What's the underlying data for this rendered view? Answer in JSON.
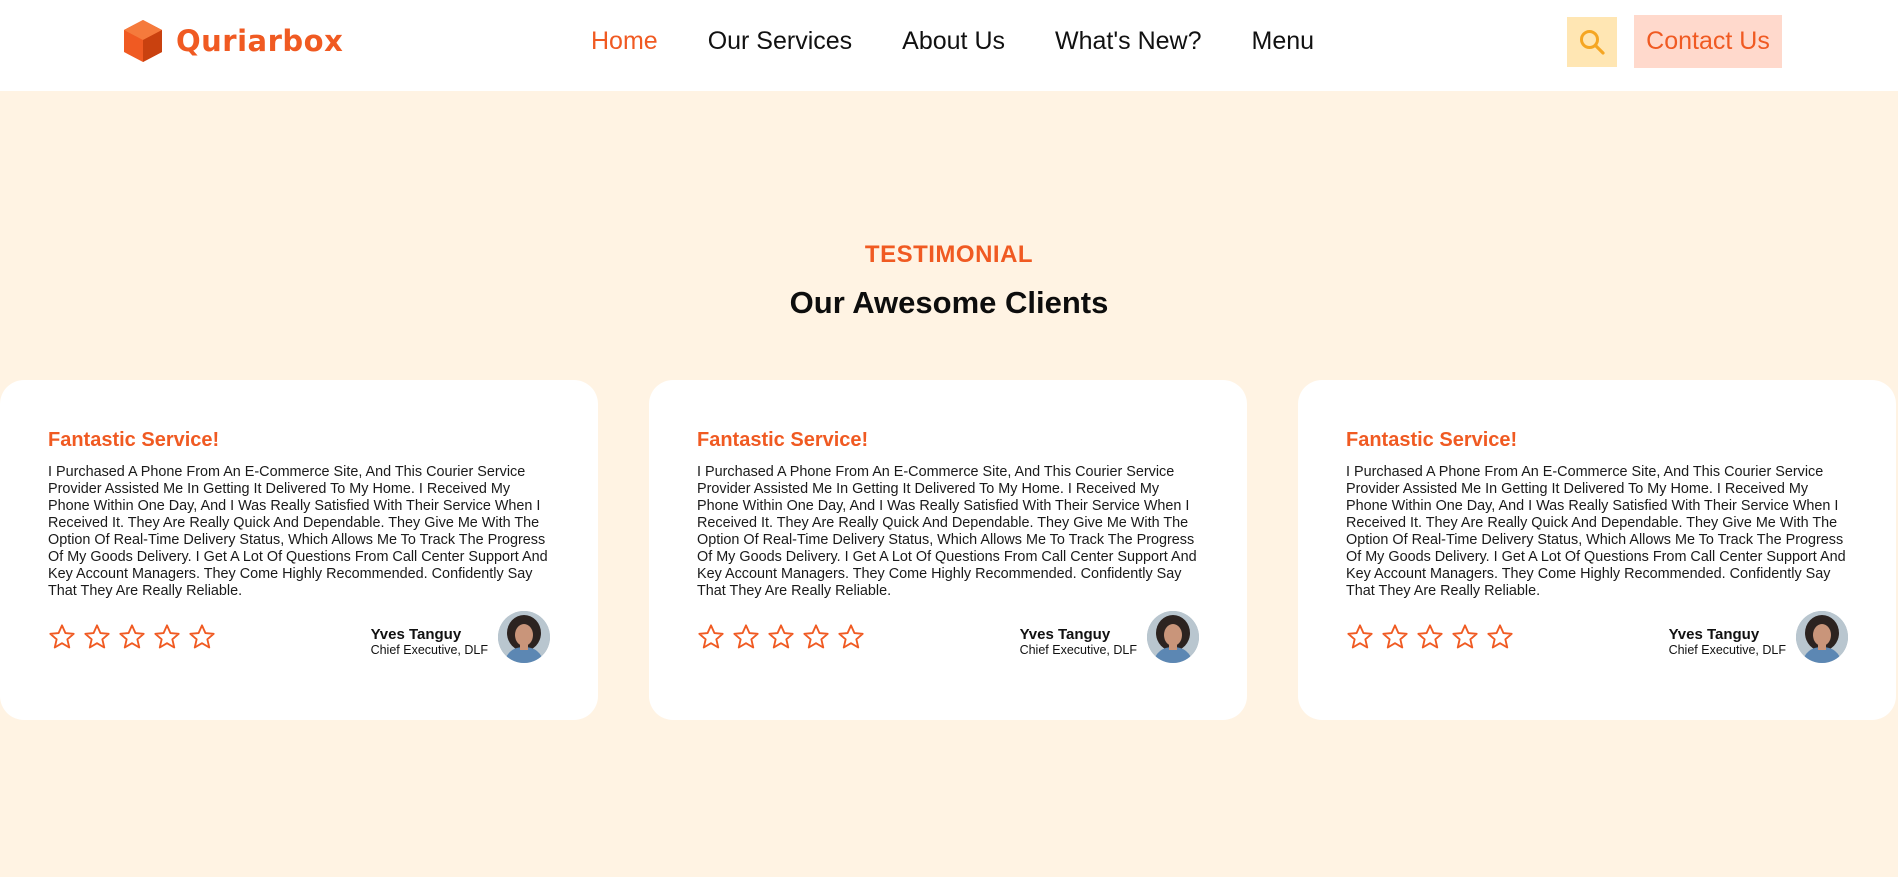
{
  "brand": {
    "name": "Quriarbox",
    "accent_color": "#f05a22",
    "background_color": "#fff3e3"
  },
  "nav": {
    "items": [
      {
        "label": "Home",
        "active": true
      },
      {
        "label": "Our Services",
        "active": false
      },
      {
        "label": "About Us",
        "active": false
      },
      {
        "label": "What's New?",
        "active": false
      },
      {
        "label": "Menu",
        "active": false
      }
    ]
  },
  "header": {
    "search_icon": "search-icon",
    "contact_label": "Contact Us"
  },
  "testimonial": {
    "eyebrow": "TESTIMONIAL",
    "title": "Our Awesome Clients",
    "cards": [
      {
        "title": "Fantastic Service!",
        "text": "I Purchased A Phone From An E-Commerce Site, And This Courier Service Provider Assisted Me In Getting It Delivered To My Home. I Received My Phone Within One Day, And I Was Really Satisfied With Their Service When I Received It. They Are Really Quick And Dependable. They Give Me With The Option Of Real-Time Delivery Status, Which Allows Me To Track The Progress Of My Goods Delivery. I Get A Lot Of Questions From Call Center Support And Key Account Managers. They Come Highly Recommended. Confidently Say That They Are Really Reliable.",
        "rating": 0,
        "rating_max": 5,
        "author": "Yves Tanguy",
        "role": "Chief Executive, DLF"
      },
      {
        "title": "Fantastic Service!",
        "text": "I Purchased A Phone From An E-Commerce Site, And This Courier Service Provider Assisted Me In Getting It Delivered To My Home. I Received My Phone Within One Day, And I Was Really Satisfied With Their Service When I Received It. They Are Really Quick And Dependable. They Give Me With The Option Of Real-Time Delivery Status, Which Allows Me To Track The Progress Of My Goods Delivery. I Get A Lot Of Questions From Call Center Support And Key Account Managers. They Come Highly Recommended. Confidently Say That They Are Really Reliable.",
        "rating": 0,
        "rating_max": 5,
        "author": "Yves Tanguy",
        "role": "Chief Executive, DLF"
      },
      {
        "title": "Fantastic Service!",
        "text": "I Purchased A Phone From An E-Commerce Site, And This Courier Service Provider Assisted Me In Getting It Delivered To My Home. I Received My Phone Within One Day, And I Was Really Satisfied With Their Service When I Received It. They Are Really Quick And Dependable. They Give Me With The Option Of Real-Time Delivery Status, Which Allows Me To Track The Progress Of My Goods Delivery. I Get A Lot Of Questions From Call Center Support And Key Account Managers. They Come Highly Recommended. Confidently Say That They Are Really Reliable.",
        "rating": 0,
        "rating_max": 5,
        "author": "Yves Tanguy",
        "role": "Chief Executive, DLF"
      }
    ]
  }
}
